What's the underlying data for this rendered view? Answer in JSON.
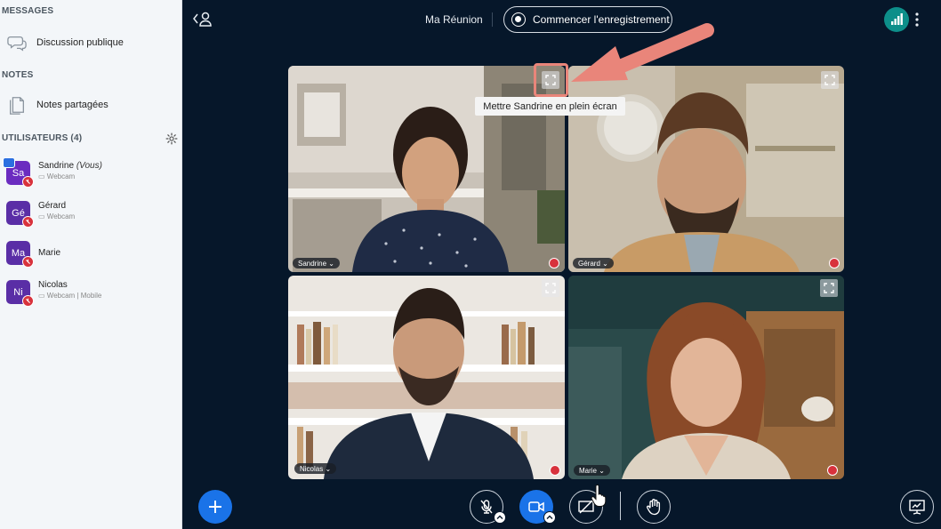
{
  "sidebar": {
    "messages_title": "MESSAGES",
    "public_chat_label": "Discussion publique",
    "notes_title": "NOTES",
    "shared_notes_label": "Notes partagées",
    "users_title": "UTILISATEURS (4)",
    "users": [
      {
        "initials": "Sa",
        "name": "Sandrine",
        "you": "(Vous)",
        "sub": "Webcam"
      },
      {
        "initials": "Gé",
        "name": "Gérard",
        "sub": "Webcam"
      },
      {
        "initials": "Ma",
        "name": "Marie",
        "sub": ""
      },
      {
        "initials": "Ni",
        "name": "Nicolas",
        "sub": "Webcam | Mobile"
      }
    ]
  },
  "topbar": {
    "meeting_title": "Ma Réunion",
    "record_label": "Commencer l'enregistrement"
  },
  "tiles": [
    {
      "name": "Sandrine"
    },
    {
      "name": "Gérard"
    },
    {
      "name": "Nicolas"
    },
    {
      "name": "Marie"
    }
  ],
  "tooltip": "Mettre Sandrine en plein écran",
  "icons": [
    "user-list-icon",
    "record-icon",
    "network-icon",
    "more-vertical-icon",
    "fullscreen-icon",
    "mic-muted-icon",
    "camera-icon",
    "screen-share-off-icon",
    "hand-raise-icon",
    "presentation-icon",
    "plus-icon",
    "chat-icon",
    "notes-icon",
    "gear-icon"
  ],
  "colors": {
    "background": "#06172a",
    "accent": "#1a73e8",
    "mute": "#d8323c",
    "highlight": "#e9857a",
    "avatar": "#5a2ea6"
  }
}
